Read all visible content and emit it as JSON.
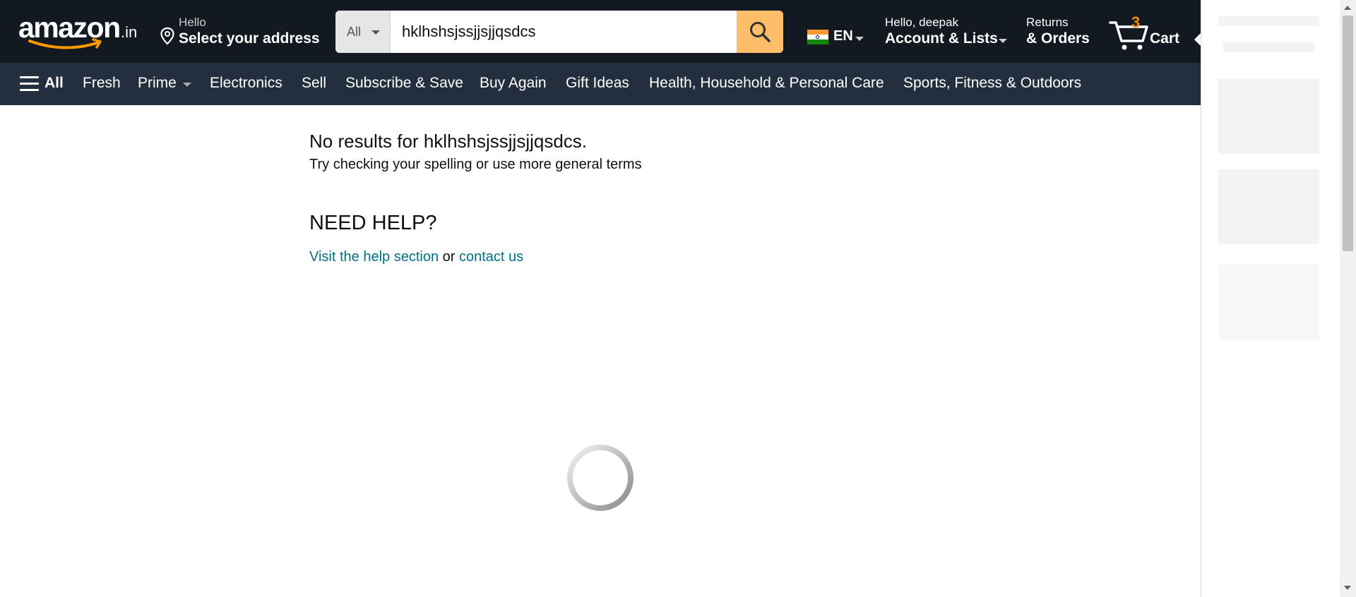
{
  "header": {
    "logo_text": "amazon",
    "logo_suffix": ".in",
    "location": {
      "line1": "Hello",
      "line2": "Select your address",
      "icon": "location-pin-icon"
    },
    "search": {
      "category": "All",
      "query": "hklhshsjssjjsjjqsdcs",
      "icon": "search-icon"
    },
    "language": {
      "code": "EN",
      "icon": "india-flag-icon"
    },
    "account": {
      "line1": "Hello, deepak",
      "line2": "Account & Lists"
    },
    "orders": {
      "line1": "Returns",
      "line2": "& Orders"
    },
    "cart": {
      "count": "3",
      "label": "Cart",
      "icon": "cart-icon"
    }
  },
  "nav": {
    "all_label": "All",
    "links": [
      "Fresh",
      "Prime",
      "Electronics",
      "Sell",
      "Subscribe & Save",
      "Buy Again",
      "Gift Ideas",
      "Health, Household & Personal Care",
      "Sports, Fitness & Outdoors"
    ]
  },
  "results": {
    "title": "No results for hklhshsjssjjsjjqsdcs.",
    "subtitle": "Try checking your spelling or use more general terms"
  },
  "help": {
    "title": "NEED HELP?",
    "link1": "Visit the help section",
    "or": "or",
    "link2": "contact us"
  },
  "colors": {
    "header_bg": "#131921",
    "nav_bg": "#232f3e",
    "search_button": "#febd69",
    "cart_count": "#f08804",
    "link": "#007185"
  }
}
